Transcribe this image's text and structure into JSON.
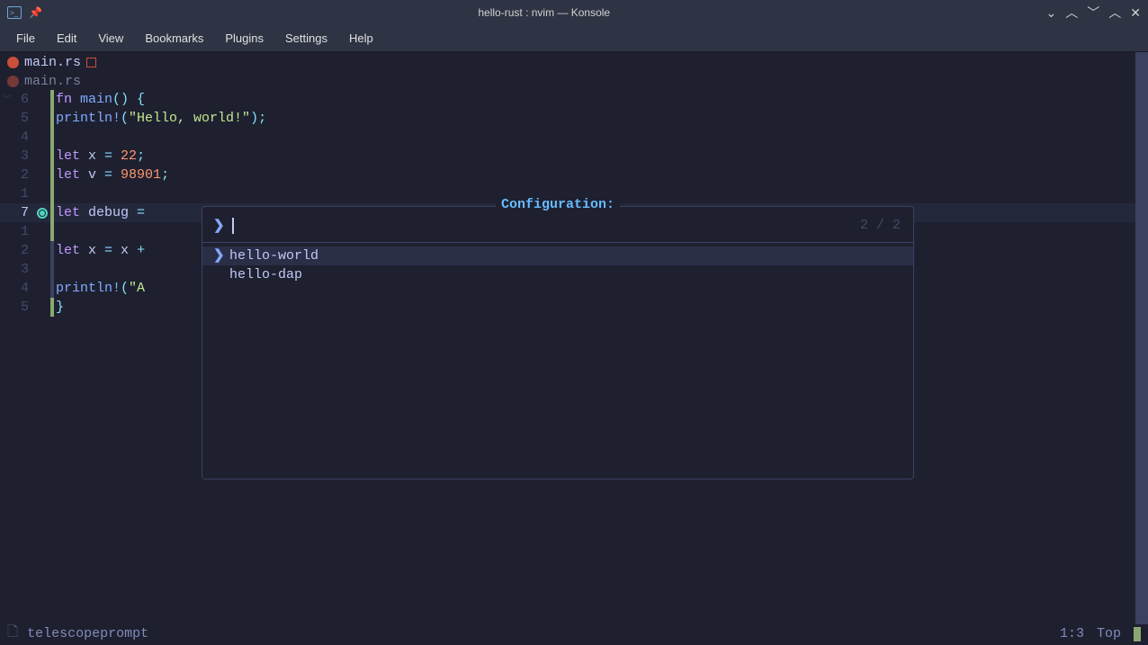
{
  "window": {
    "title": "hello-rust : nvim — Konsole"
  },
  "menubar": [
    "File",
    "Edit",
    "View",
    "Bookmarks",
    "Plugins",
    "Settings",
    "Help"
  ],
  "tabs": [
    {
      "name": "main.rs",
      "active": true,
      "modified": true
    },
    {
      "name": "main.rs",
      "active": false,
      "modified": false
    }
  ],
  "gutter": [
    "6",
    "5",
    "4",
    "3",
    "2",
    "1",
    "7",
    "1",
    "2",
    "3",
    "4",
    "5"
  ],
  "gutter_current_index": 6,
  "code": {
    "l0": {
      "kw": "fn ",
      "fn": "main",
      "p1": "()",
      "p2": " {"
    },
    "l1": {
      "indent": "    ",
      "macro": "println!",
      "p1": "(",
      "str": "\"Hello, world!\"",
      "p2": ");"
    },
    "l2": {
      "blank": ""
    },
    "l3": {
      "indent": "    ",
      "kw": "let ",
      "id": "x",
      "op": " = ",
      "num": "22",
      "p": ";"
    },
    "l4": {
      "indent": "    ",
      "kw": "let ",
      "id": "v",
      "op": " = ",
      "num": "98901",
      "p": ";"
    },
    "l5": {
      "blank": ""
    },
    "l6": {
      "indent": "    ",
      "kw": "let ",
      "id": "debug",
      "op": " = "
    },
    "l7": {
      "blank": ""
    },
    "l8": {
      "indent": "    ",
      "kw": "let ",
      "id": "x",
      "op": " = ",
      "id2": "x",
      "op2": " + "
    },
    "l9": {
      "blank": ""
    },
    "l10": {
      "indent": "    ",
      "macro": "println!",
      "p1": "(",
      "str": "\"A"
    },
    "l11": {
      "p": "}"
    }
  },
  "popup": {
    "title": "Configuration:",
    "count": "2 / 2",
    "items": [
      {
        "label": "hello-world",
        "selected": true
      },
      {
        "label": "hello-dap",
        "selected": false
      }
    ]
  },
  "statusbar": {
    "mode_text": "telescopeprompt",
    "position": "1:3",
    "scroll": "Top"
  }
}
